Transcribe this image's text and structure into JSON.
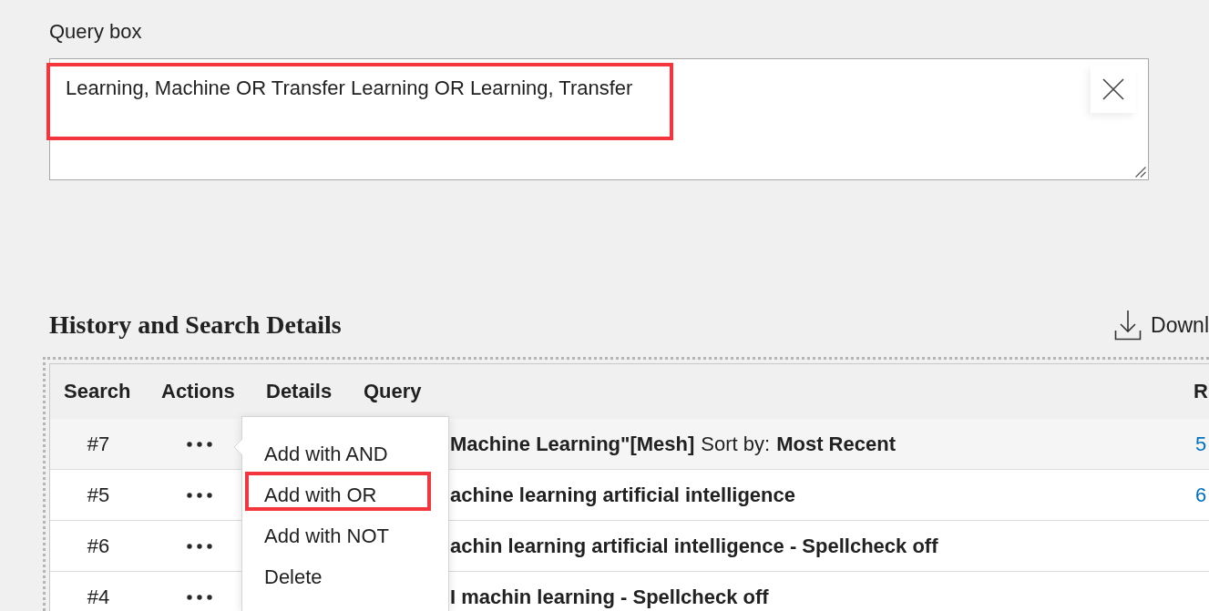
{
  "query_box": {
    "label": "Query box",
    "value": "Learning, Machine OR Transfer Learning OR Learning, Transfer",
    "highlighted": true
  },
  "history": {
    "title": "History and Search Details",
    "download": {
      "label": "Downl"
    },
    "columns": [
      "Search",
      "Actions",
      "Details",
      "Query",
      "R"
    ],
    "rows": [
      {
        "search": "#7",
        "query": "Machine Learning\"[Mesh]",
        "sort_label": "Sort by:",
        "sort_value": "Most Recent",
        "results": "5",
        "selected": true
      },
      {
        "search": "#5",
        "query": "achine learning artificial intelligence",
        "results": "6",
        "selected": false
      },
      {
        "search": "#6",
        "query": "achin learning artificial intelligence - Spellcheck off",
        "selected": false
      },
      {
        "search": "#4",
        "query": "I machin learning - Spellcheck off",
        "selected": false
      }
    ],
    "actions_menu": {
      "items": [
        {
          "label": "Add with AND",
          "highlighted": false
        },
        {
          "label": "Add with OR",
          "highlighted": true
        },
        {
          "label": "Add with NOT",
          "highlighted": false
        },
        {
          "label": "Delete",
          "highlighted": false
        }
      ]
    }
  }
}
